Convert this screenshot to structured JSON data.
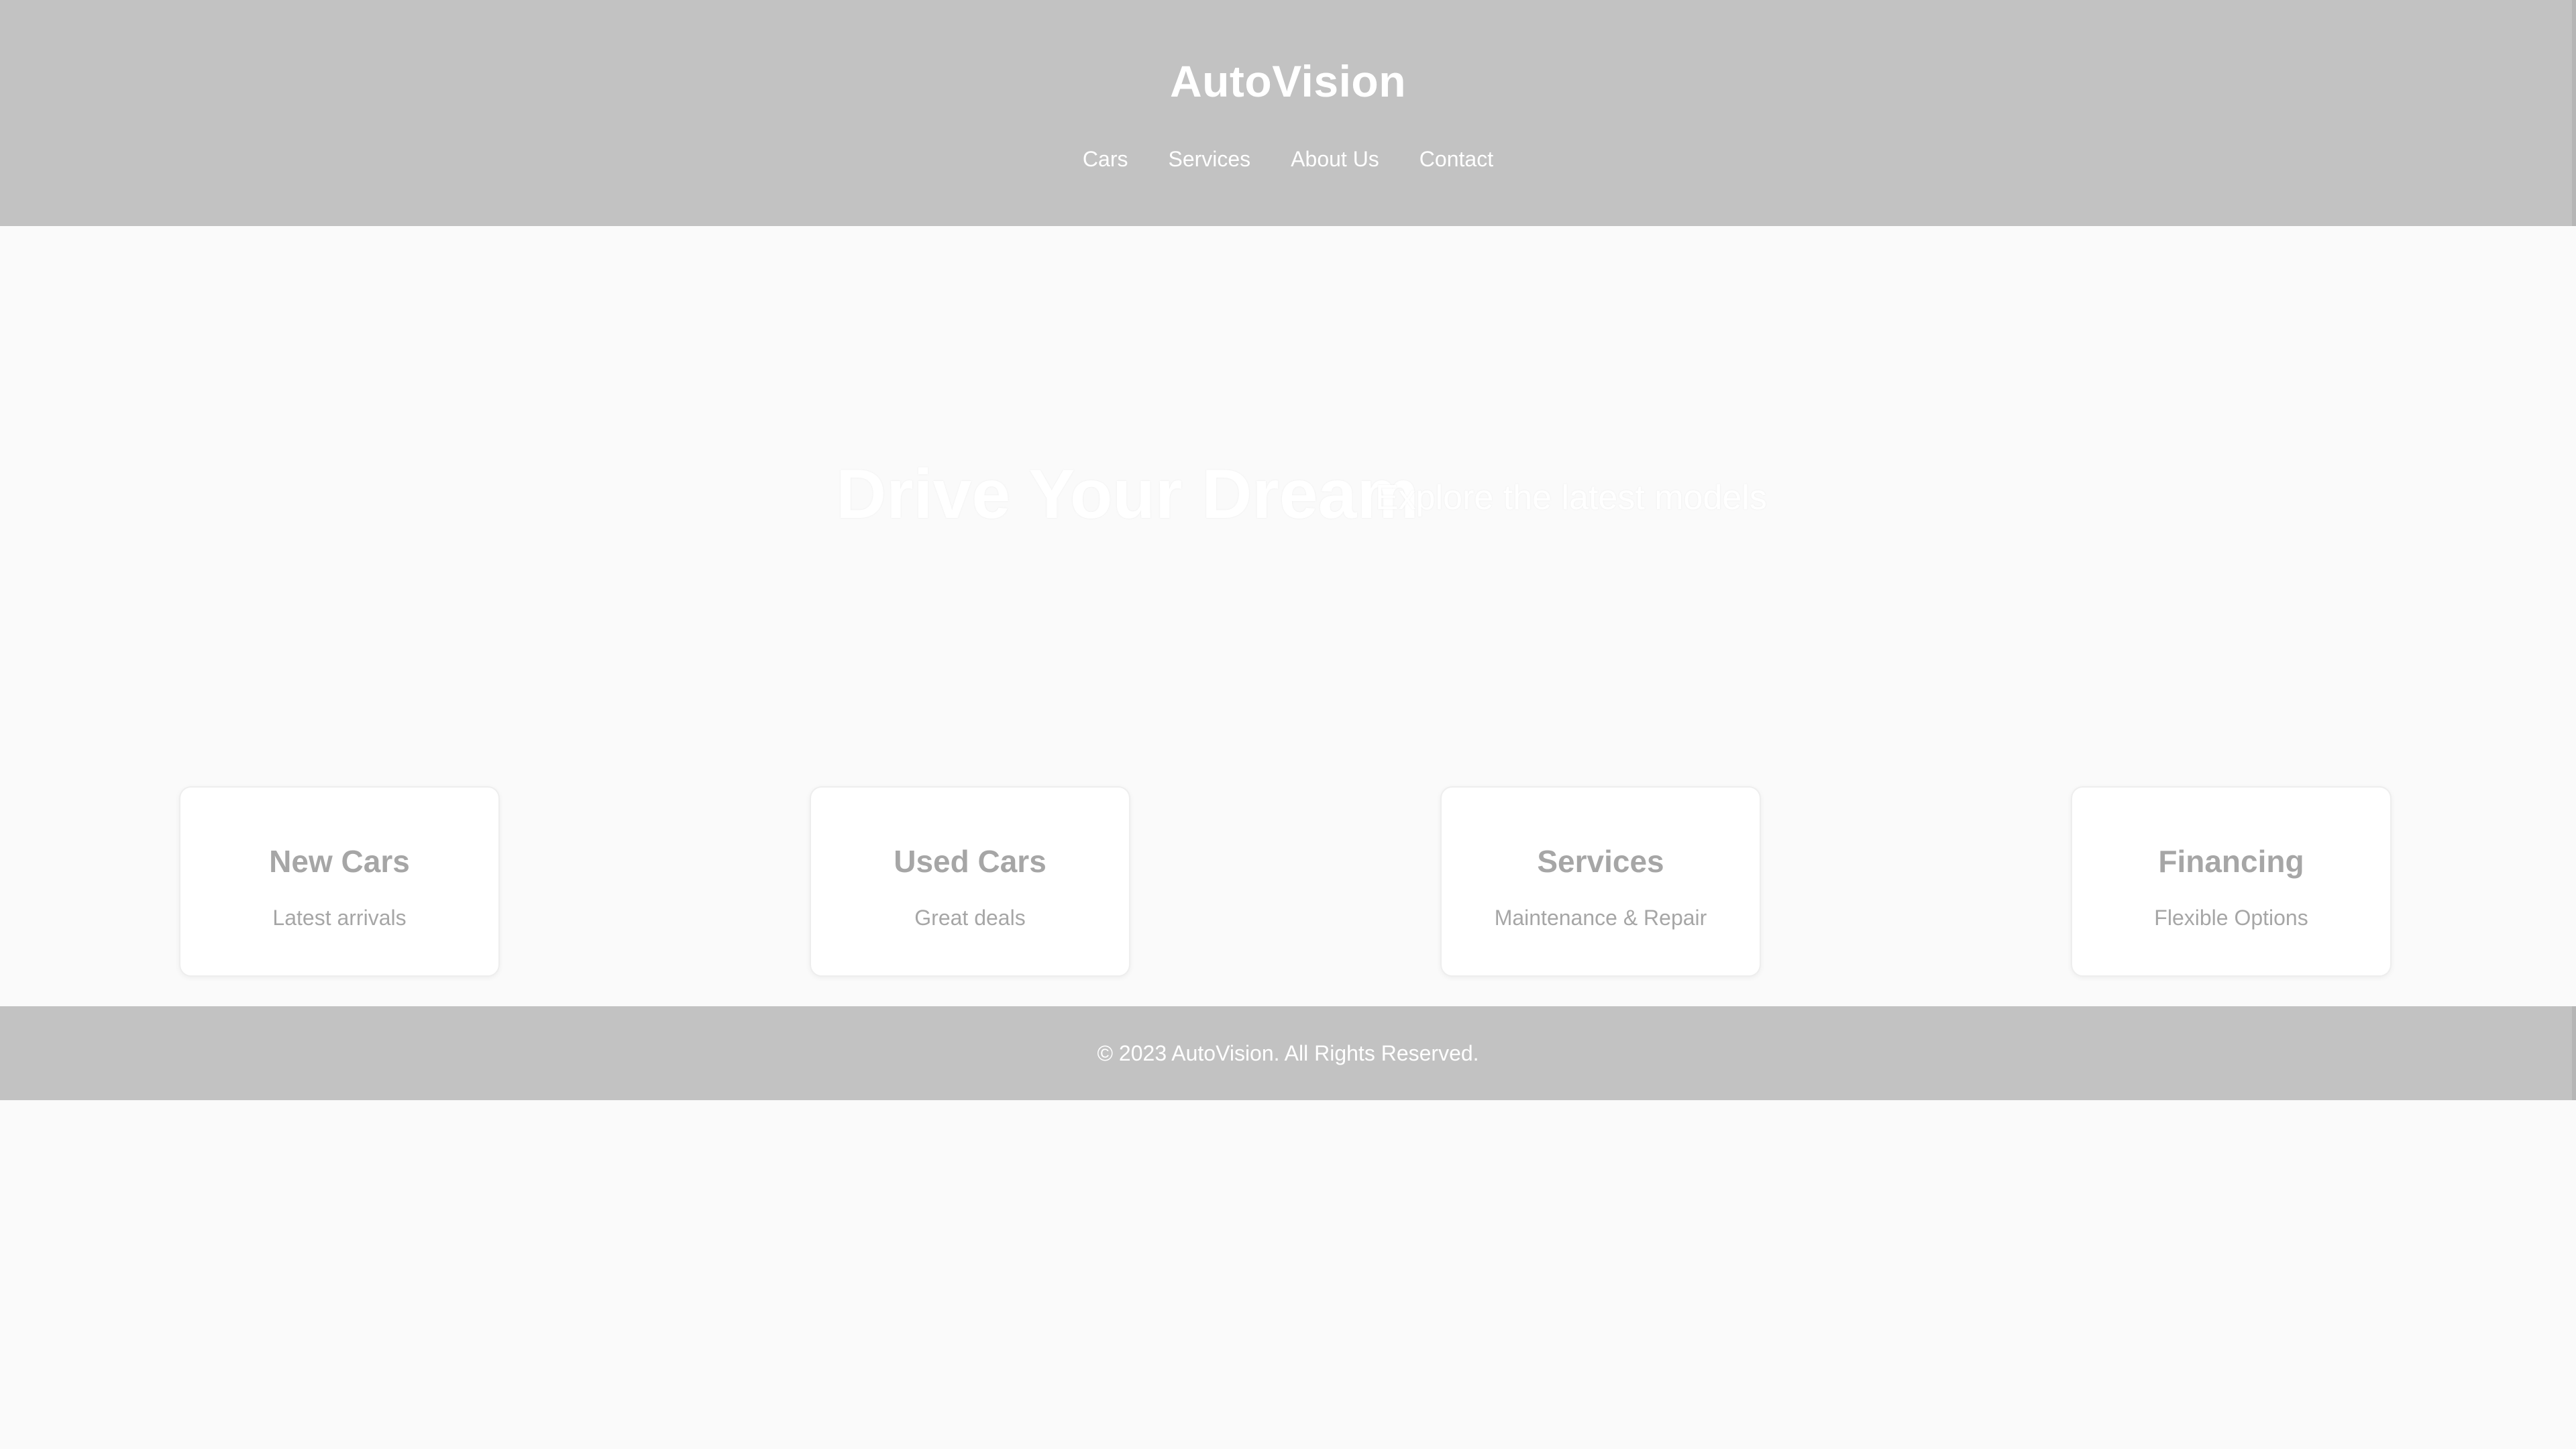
{
  "header": {
    "brand": "AutoVision",
    "nav": [
      {
        "label": "Cars"
      },
      {
        "label": "Services"
      },
      {
        "label": "About Us"
      },
      {
        "label": "Contact"
      }
    ]
  },
  "hero": {
    "title": "Drive Your Dream",
    "subtitle": "Explore the latest models"
  },
  "cards": [
    {
      "title": "New Cars",
      "desc": "Latest arrivals"
    },
    {
      "title": "Used Cars",
      "desc": "Great deals"
    },
    {
      "title": "Services",
      "desc": "Maintenance & Repair"
    },
    {
      "title": "Financing",
      "desc": "Flexible Options"
    }
  ],
  "footer": {
    "text": "© 2023 AutoVision. All Rights Reserved."
  },
  "colors": {
    "header_bg": "#c2c2c2",
    "page_bg": "#fafafa",
    "card_text": "#a6a6a6",
    "light_text": "#ffffff"
  }
}
